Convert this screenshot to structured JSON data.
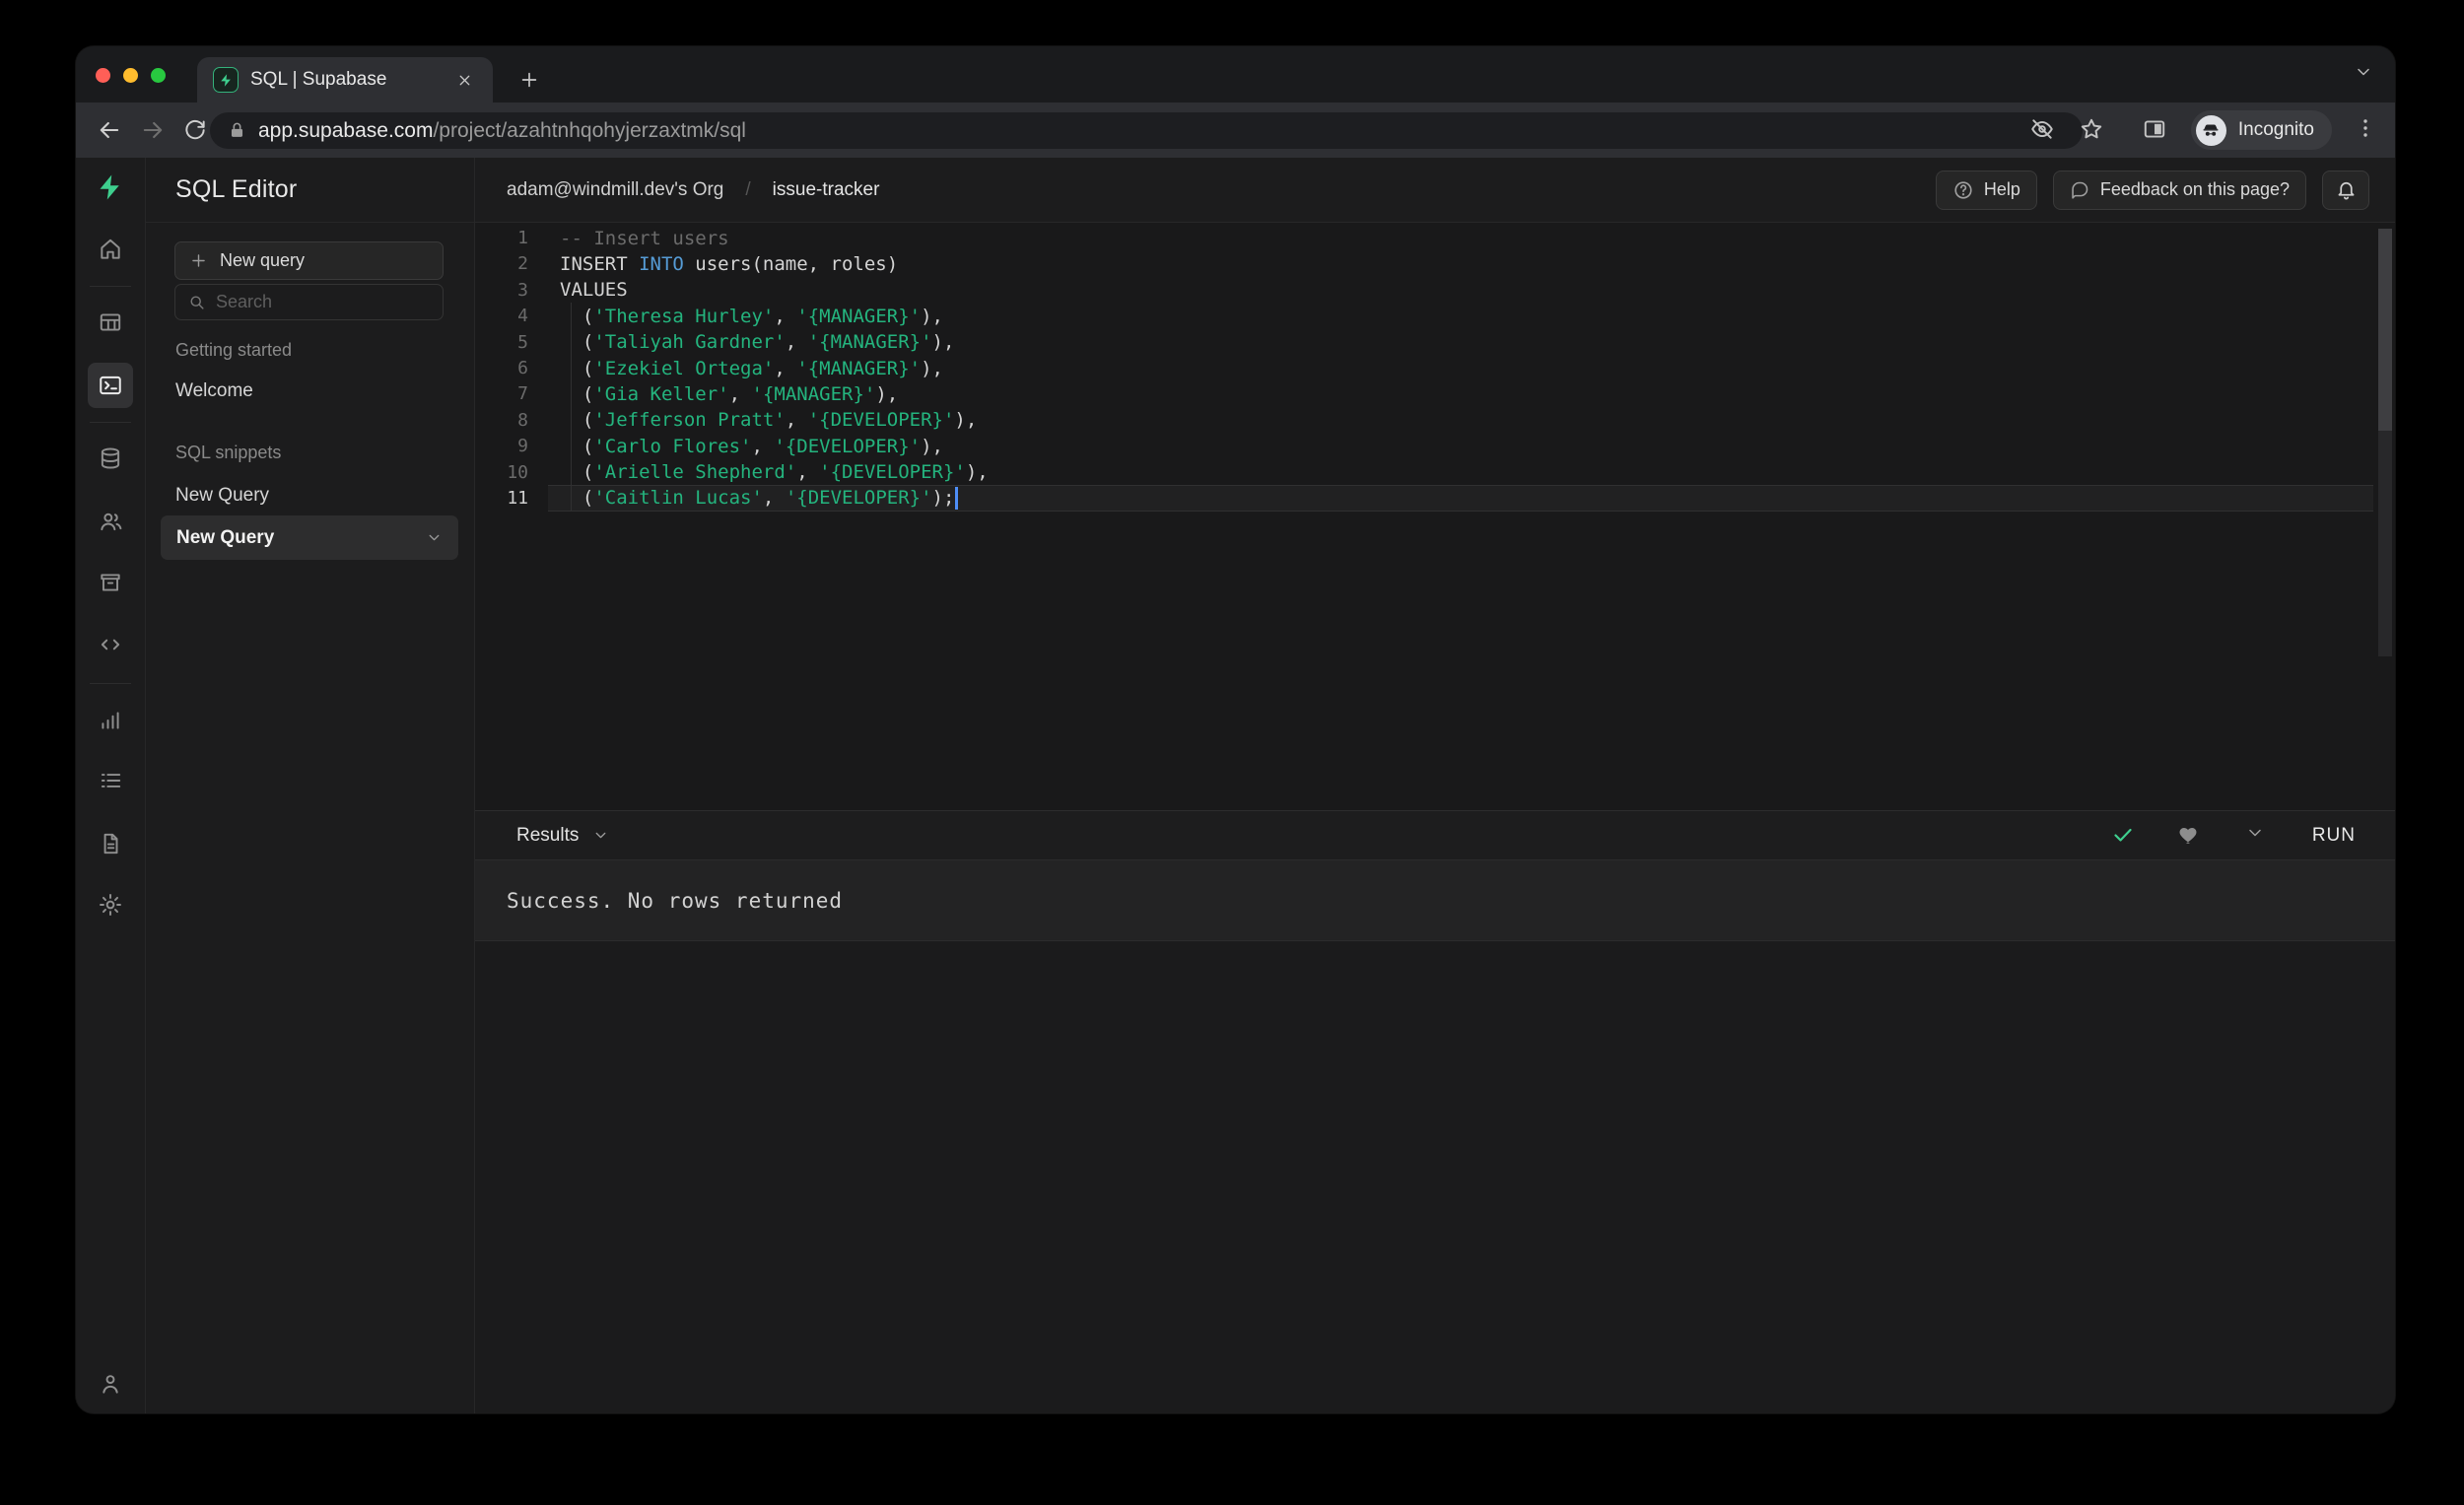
{
  "browser": {
    "tab": {
      "title": "SQL | Supabase",
      "favicon": "supabase-bolt-icon"
    },
    "url": {
      "domain": "app.supabase.com",
      "path": "/project/azahtnhqohyjerzaxtmk/sql"
    },
    "incognito_label": "Incognito"
  },
  "app": {
    "title": "SQL Editor",
    "breadcrumb": {
      "org": "adam@windmill.dev's Org",
      "separator": "/",
      "project": "issue-tracker"
    },
    "actions": {
      "help": "Help",
      "feedback": "Feedback on this page?"
    },
    "rail_icons": [
      {
        "name": "home-icon",
        "icon": "home",
        "active": false,
        "divider_after": true
      },
      {
        "name": "table-editor-icon",
        "icon": "table",
        "active": false,
        "divider_after": false
      },
      {
        "name": "sql-editor-icon",
        "icon": "terminal",
        "active": true,
        "divider_after": true
      },
      {
        "name": "database-icon",
        "icon": "database",
        "active": false,
        "divider_after": false
      },
      {
        "name": "auth-icon",
        "icon": "users",
        "active": false,
        "divider_after": false
      },
      {
        "name": "storage-icon",
        "icon": "archive",
        "active": false,
        "divider_after": false
      },
      {
        "name": "edge-functions-icon",
        "icon": "code",
        "active": false,
        "divider_after": true
      },
      {
        "name": "reports-icon",
        "icon": "chart",
        "active": false,
        "divider_after": false
      },
      {
        "name": "logs-icon",
        "icon": "list",
        "active": false,
        "divider_after": false
      },
      {
        "name": "api-docs-icon",
        "icon": "file",
        "active": false,
        "divider_after": false
      },
      {
        "name": "settings-icon",
        "icon": "gear",
        "active": false,
        "divider_after": false
      }
    ],
    "panel": {
      "new_query_button": "New query",
      "search_placeholder": "Search",
      "sections": [
        {
          "label": "Getting started",
          "items": [
            {
              "label": "Welcome",
              "selected": false
            }
          ]
        },
        {
          "label": "SQL snippets",
          "items": [
            {
              "label": "New Query",
              "selected": false
            },
            {
              "label": "New Query",
              "selected": true
            }
          ]
        }
      ]
    },
    "editor": {
      "lines": [
        {
          "num": "1",
          "segments": [
            {
              "text": "-- Insert users",
              "type": "comment"
            }
          ]
        },
        {
          "num": "2",
          "segments": [
            {
              "text": "INSERT ",
              "type": "plain"
            },
            {
              "text": "INTO",
              "type": "keyword"
            },
            {
              "text": " users(name, roles)",
              "type": "plain"
            }
          ]
        },
        {
          "num": "3",
          "segments": [
            {
              "text": "VALUES",
              "type": "plain"
            }
          ]
        },
        {
          "num": "4",
          "segments": [
            {
              "text": "  (",
              "type": "plain"
            },
            {
              "text": "'Theresa Hurley'",
              "type": "string"
            },
            {
              "text": ", ",
              "type": "plain"
            },
            {
              "text": "'{MANAGER}'",
              "type": "string"
            },
            {
              "text": "),",
              "type": "plain"
            }
          ]
        },
        {
          "num": "5",
          "segments": [
            {
              "text": "  (",
              "type": "plain"
            },
            {
              "text": "'Taliyah Gardner'",
              "type": "string"
            },
            {
              "text": ", ",
              "type": "plain"
            },
            {
              "text": "'{MANAGER}'",
              "type": "string"
            },
            {
              "text": "),",
              "type": "plain"
            }
          ]
        },
        {
          "num": "6",
          "segments": [
            {
              "text": "  (",
              "type": "plain"
            },
            {
              "text": "'Ezekiel Ortega'",
              "type": "string"
            },
            {
              "text": ", ",
              "type": "plain"
            },
            {
              "text": "'{MANAGER}'",
              "type": "string"
            },
            {
              "text": "),",
              "type": "plain"
            }
          ]
        },
        {
          "num": "7",
          "segments": [
            {
              "text": "  (",
              "type": "plain"
            },
            {
              "text": "'Gia Keller'",
              "type": "string"
            },
            {
              "text": ", ",
              "type": "plain"
            },
            {
              "text": "'{MANAGER}'",
              "type": "string"
            },
            {
              "text": "),",
              "type": "plain"
            }
          ]
        },
        {
          "num": "8",
          "segments": [
            {
              "text": "  (",
              "type": "plain"
            },
            {
              "text": "'Jefferson Pratt'",
              "type": "string"
            },
            {
              "text": ", ",
              "type": "plain"
            },
            {
              "text": "'{DEVELOPER}'",
              "type": "string"
            },
            {
              "text": "),",
              "type": "plain"
            }
          ]
        },
        {
          "num": "9",
          "segments": [
            {
              "text": "  (",
              "type": "plain"
            },
            {
              "text": "'Carlo Flores'",
              "type": "string"
            },
            {
              "text": ", ",
              "type": "plain"
            },
            {
              "text": "'{DEVELOPER}'",
              "type": "string"
            },
            {
              "text": "),",
              "type": "plain"
            }
          ]
        },
        {
          "num": "10",
          "segments": [
            {
              "text": "  (",
              "type": "plain"
            },
            {
              "text": "'Arielle Shepherd'",
              "type": "string"
            },
            {
              "text": ", ",
              "type": "plain"
            },
            {
              "text": "'{DEVELOPER}'",
              "type": "string"
            },
            {
              "text": "),",
              "type": "plain"
            }
          ]
        },
        {
          "num": "11",
          "segments": [
            {
              "text": "  (",
              "type": "plain"
            },
            {
              "text": "'Caitlin Lucas'",
              "type": "string"
            },
            {
              "text": ", ",
              "type": "plain"
            },
            {
              "text": "'{DEVELOPER}'",
              "type": "string"
            },
            {
              "text": ");",
              "type": "plain"
            }
          ],
          "current": true,
          "cursor": true
        }
      ]
    },
    "results": {
      "label": "Results",
      "message": "Success. No rows returned",
      "run_label": "RUN"
    },
    "colors": {
      "accent": "#3ecf8e",
      "keyword": "#569cd6",
      "string": "#24b47e",
      "comment": "#6b6b6b"
    }
  }
}
